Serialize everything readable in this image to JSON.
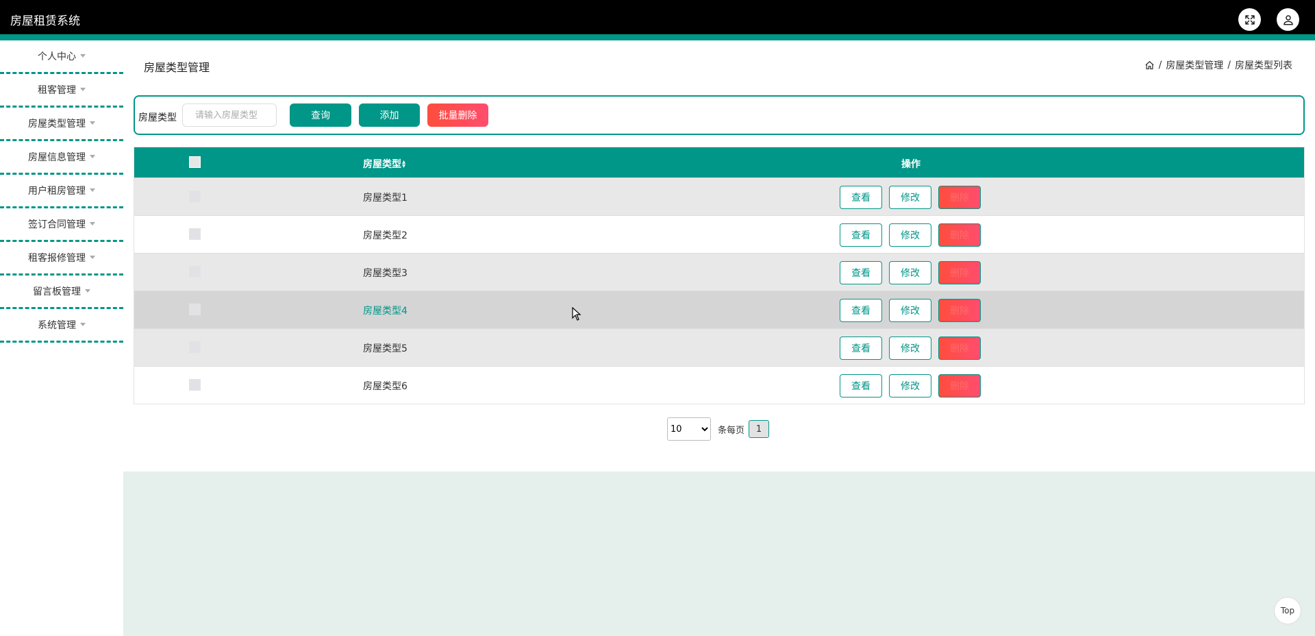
{
  "app": {
    "title": "房屋租赁系统"
  },
  "header": {
    "fullscreen_icon": "expand-icon",
    "user_icon": "user-icon"
  },
  "sidebar": {
    "items": [
      {
        "label": "个人中心"
      },
      {
        "label": "租客管理"
      },
      {
        "label": "房屋类型管理"
      },
      {
        "label": "房屋信息管理"
      },
      {
        "label": "用户租房管理"
      },
      {
        "label": "签订合同管理"
      },
      {
        "label": "租客报修管理"
      },
      {
        "label": "留言板管理"
      },
      {
        "label": "系统管理"
      }
    ]
  },
  "page": {
    "title": "房屋类型管理",
    "breadcrumb": {
      "home_icon": "home-icon",
      "sep1": "/",
      "level1": "房屋类型管理",
      "sep2": "/",
      "level2": "房屋类型列表"
    }
  },
  "search": {
    "label": "房屋类型",
    "placeholder": "请输入房屋类型",
    "query_label": "查询",
    "add_label": "添加",
    "batch_delete_label": "批量删除"
  },
  "table": {
    "headers": {
      "name": "房屋类型",
      "sort_icon": "sort-icon",
      "actions": "操作"
    },
    "rows": [
      {
        "name": "房屋类型1"
      },
      {
        "name": "房屋类型2"
      },
      {
        "name": "房屋类型3"
      },
      {
        "name": "房屋类型4"
      },
      {
        "name": "房屋类型5"
      },
      {
        "name": "房屋类型6"
      }
    ],
    "actions": {
      "view": "查看",
      "edit": "修改",
      "delete": "删除"
    }
  },
  "pagination": {
    "page_size": "10",
    "per_page_label": "条每页",
    "current_page": "1"
  },
  "back_to_top": {
    "label": "Top"
  },
  "colors": {
    "accent": "#009688",
    "danger": "#ff4d4f",
    "header_bg": "#000000",
    "panel_bg": "#e5efec"
  }
}
